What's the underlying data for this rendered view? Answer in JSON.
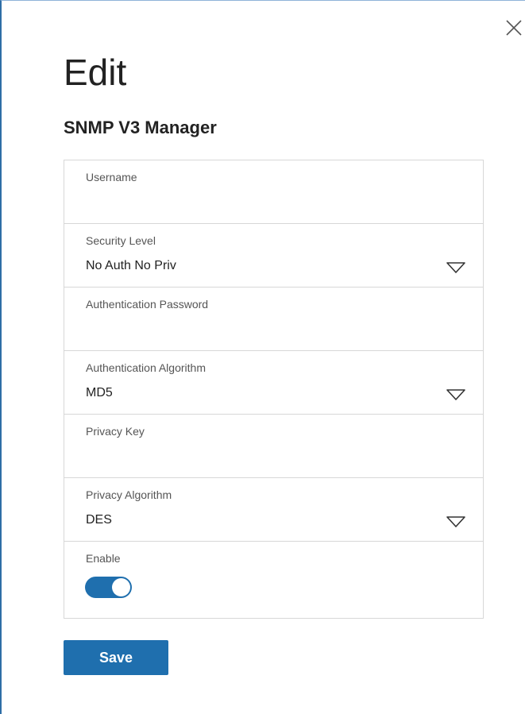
{
  "dialog": {
    "title": "Edit",
    "subtitle": "SNMP V3 Manager",
    "close_icon": "close-icon",
    "save_label": "Save"
  },
  "form": {
    "username": {
      "label": "Username",
      "value": ""
    },
    "security_level": {
      "label": "Security Level",
      "value": "No Auth No Priv",
      "icon": "chevron-down-icon"
    },
    "auth_password": {
      "label": "Authentication Password",
      "value": ""
    },
    "auth_algorithm": {
      "label": "Authentication Algorithm",
      "value": "MD5",
      "icon": "chevron-down-icon"
    },
    "privacy_key": {
      "label": "Privacy Key",
      "value": ""
    },
    "privacy_algorithm": {
      "label": "Privacy Algorithm",
      "value": "DES",
      "icon": "chevron-down-icon"
    },
    "enable": {
      "label": "Enable",
      "on": true
    }
  },
  "colors": {
    "accent": "#1f6fae",
    "border": "#d7d7d7",
    "text": "#222222",
    "label": "#555555"
  }
}
